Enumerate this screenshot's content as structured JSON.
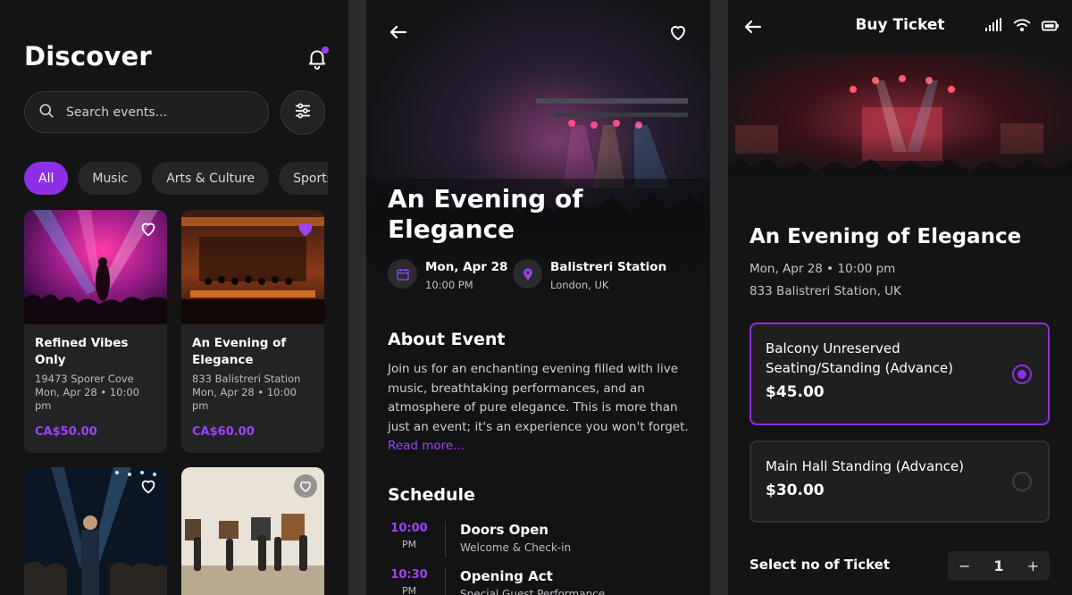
{
  "discover": {
    "title": "Discover",
    "search_placeholder": "Search events...",
    "chips": [
      "All",
      "Music",
      "Arts & Culture",
      "Sports"
    ],
    "cards": [
      {
        "title": "Refined Vibes Only",
        "meta": "19473 Sporer Cove\nMon, Apr 28 • 10:00 pm",
        "price": "CA$50.00",
        "favorited": false
      },
      {
        "title": "An Evening of Elegance",
        "meta": "833 Balistreri Station\nMon, Apr 28 • 10:00 pm",
        "price": "CA$60.00",
        "favorited": true
      }
    ]
  },
  "event": {
    "title": "An Evening of Elegance",
    "date": "Mon, Apr 28",
    "time": "10:00 PM",
    "venue": "Balistreri Station",
    "location": "London, UK",
    "about_heading": "About Event",
    "about_text": "Join us for an enchanting evening filled with live music, breathtaking performances, and an atmosphere of pure elegance. This is more than just an event; it's an experience you won't forget.",
    "read_more": "Read more...",
    "schedule_heading": "Schedule",
    "schedule": [
      {
        "time": "10:00",
        "ampm": "PM",
        "title": "Doors Open",
        "sub": "Welcome & Check-in"
      },
      {
        "time": "10:30",
        "ampm": "PM",
        "title": "Opening Act",
        "sub": "Special Guest Performance"
      }
    ]
  },
  "ticket": {
    "header": "Buy Ticket",
    "title": "An Evening of Elegance",
    "datetime": "Mon, Apr 28 • 10:00 pm",
    "address": "833 Balistreri Station, UK",
    "options": [
      {
        "name": "Balcony Unreserved Seating/Standing (Advance)",
        "price": "$45.00",
        "selected": true
      },
      {
        "name": "Main Hall Standing (Advance)",
        "price": "$30.00",
        "selected": false
      }
    ],
    "qty_label": "Select no of Ticket",
    "qty": "1",
    "minus": "−",
    "plus": "+"
  },
  "colors": {
    "accent": "#8c2fe6",
    "price": "#9b45f2",
    "bg": "#141415",
    "card": "#232326"
  }
}
